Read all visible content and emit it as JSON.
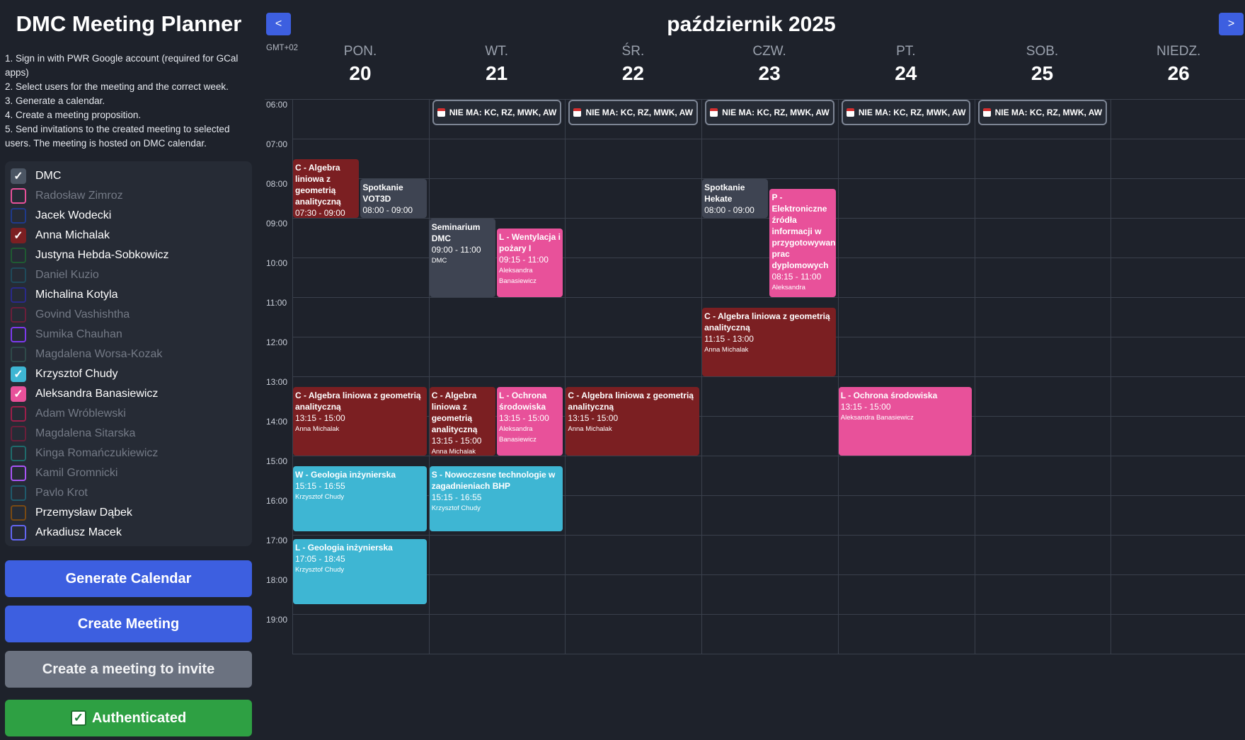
{
  "sidebar": {
    "title": "DMC Meeting Planner",
    "instructions": [
      "1. Sign in with PWR Google account (required for GCal apps)",
      "2. Select users for the meeting and the correct week.",
      "3. Generate a calendar.",
      "4. Create a meeting proposition.",
      "5. Send invitations to the created meeting to selected users. The meeting is hosted on DMC calendar."
    ],
    "users": [
      {
        "name": "DMC",
        "checked": true,
        "color": "#4b5563"
      },
      {
        "name": "Radosław Zimroz",
        "checked": false,
        "color": "#e8519a"
      },
      {
        "name": "Jacek Wodecki",
        "checked": false,
        "color": "#1f3a8a"
      },
      {
        "name": "Anna Michalak",
        "checked": true,
        "color": "#7b1f22"
      },
      {
        "name": "Justyna Hebda-Sobkowicz",
        "checked": false,
        "color": "#1f5a32"
      },
      {
        "name": "Daniel Kuzio",
        "checked": false,
        "color": "#1f4a5a"
      },
      {
        "name": "Michalina Kotyla",
        "checked": false,
        "color": "#2a2a8a"
      },
      {
        "name": "Govind Vashishtha",
        "checked": false,
        "color": "#6b1f3a"
      },
      {
        "name": "Sumika Chauhan",
        "checked": false,
        "color": "#7c3aed"
      },
      {
        "name": "Magdalena Worsa-Kozak",
        "checked": false,
        "color": "#2f4a4a"
      },
      {
        "name": "Krzysztof Chudy",
        "checked": true,
        "color": "#3eb6d3"
      },
      {
        "name": "Aleksandra Banasiewicz",
        "checked": true,
        "color": "#e8519a"
      },
      {
        "name": "Adam Wróblewski",
        "checked": false,
        "color": "#9d1f4a"
      },
      {
        "name": "Magdalena Sitarska",
        "checked": false,
        "color": "#6b1f3a"
      },
      {
        "name": "Kinga Romańczukiewicz",
        "checked": false,
        "color": "#1f6b6b"
      },
      {
        "name": "Kamil Gromnicki",
        "checked": false,
        "color": "#a855f7"
      },
      {
        "name": "Pavlo Krot",
        "checked": false,
        "color": "#1f5a6b"
      },
      {
        "name": "Przemysław Dąbek",
        "checked": false,
        "color": "#7a4a12"
      },
      {
        "name": "Arkadiusz Macek",
        "checked": false,
        "color": "#6366f1"
      }
    ],
    "buttons": {
      "generate": "Generate Calendar",
      "create_meeting": "Create Meeting",
      "create_invite": "Create a meeting to invite",
      "authenticated": "Authenticated",
      "authenticated_icon": "check-box-icon"
    }
  },
  "calendar": {
    "prev": "<",
    "next": ">",
    "month_title": "październik 2025",
    "timezone": "GMT+02",
    "days": [
      {
        "name": "PON.",
        "num": "20"
      },
      {
        "name": "WT.",
        "num": "21"
      },
      {
        "name": "ŚR.",
        "num": "22"
      },
      {
        "name": "CZW.",
        "num": "23"
      },
      {
        "name": "PT.",
        "num": "24"
      },
      {
        "name": "SOB.",
        "num": "25"
      },
      {
        "name": "NIEDZ.",
        "num": "26"
      }
    ],
    "hours": [
      "06:00",
      "07:00",
      "08:00",
      "09:00",
      "10:00",
      "11:00",
      "12:00",
      "13:00",
      "14:00",
      "15:00",
      "16:00",
      "17:00",
      "18:00",
      "19:00"
    ],
    "allday_label": "NIE MA: KC, RZ, MWK, AW",
    "allday_days": [
      1,
      2,
      3,
      4,
      5
    ],
    "events": [
      {
        "day": 0,
        "lane": 0,
        "lanes": 2,
        "start": "07:30",
        "end": "09:00",
        "color": "red",
        "title": "C - Algebra liniowa z geometrią analityczną",
        "time": "07:30 - 09:00",
        "who": ""
      },
      {
        "day": 0,
        "lane": 1,
        "lanes": 2,
        "start": "08:00",
        "end": "09:00",
        "color": "slate",
        "title": "Spotkanie VOT3D",
        "time": "08:00 - 09:00",
        "who": ""
      },
      {
        "day": 1,
        "lane": 0,
        "lanes": 2,
        "start": "09:00",
        "end": "11:00",
        "color": "slate",
        "title": "Seminarium DMC",
        "time": "09:00 - 11:00",
        "who": "DMC"
      },
      {
        "day": 1,
        "lane": 1,
        "lanes": 2,
        "start": "09:15",
        "end": "11:00",
        "color": "pink",
        "title": "L - Wentylacja i pożary I",
        "time": "09:15 - 11:00",
        "who": "Aleksandra Banasiewicz"
      },
      {
        "day": 3,
        "lane": 0,
        "lanes": 2,
        "start": "08:00",
        "end": "09:00",
        "color": "slate",
        "title": "Spotkanie Hekate",
        "time": "08:00 - 09:00",
        "who": ""
      },
      {
        "day": 3,
        "lane": 1,
        "lanes": 2,
        "start": "08:15",
        "end": "11:00",
        "color": "pink",
        "title": "P - Elektroniczne źródła informacji w przygotowywaniu prac dyplomowych",
        "time": "08:15 - 11:00",
        "who": "Aleksandra"
      },
      {
        "day": 3,
        "lane": 0,
        "lanes": 1,
        "start": "11:15",
        "end": "13:00",
        "color": "red",
        "title": "C - Algebra liniowa z geometrią analityczną",
        "time": "11:15 - 13:00",
        "who": "Anna Michalak"
      },
      {
        "day": 0,
        "lane": 0,
        "lanes": 1,
        "start": "13:15",
        "end": "15:00",
        "color": "red",
        "title": "C - Algebra liniowa z geometrią analityczną",
        "time": "13:15 - 15:00",
        "who": "Anna Michalak"
      },
      {
        "day": 1,
        "lane": 0,
        "lanes": 2,
        "start": "13:15",
        "end": "15:00",
        "color": "red",
        "title": "C - Algebra liniowa z geometrią analityczną",
        "time": "13:15 - 15:00",
        "who": "Anna Michalak"
      },
      {
        "day": 1,
        "lane": 1,
        "lanes": 2,
        "start": "13:15",
        "end": "15:00",
        "color": "pink",
        "title": "L - Ochrona środowiska",
        "time": "13:15 - 15:00",
        "who": "Aleksandra Banasiewicz"
      },
      {
        "day": 2,
        "lane": 0,
        "lanes": 1,
        "start": "13:15",
        "end": "15:00",
        "color": "red",
        "title": "C - Algebra liniowa z geometrią analityczną",
        "time": "13:15 - 15:00",
        "who": "Anna Michalak"
      },
      {
        "day": 4,
        "lane": 0,
        "lanes": 1,
        "start": "13:15",
        "end": "15:00",
        "color": "pink",
        "title": "L - Ochrona środowiska",
        "time": "13:15 - 15:00",
        "who": "Aleksandra Banasiewicz"
      },
      {
        "day": 0,
        "lane": 0,
        "lanes": 1,
        "start": "15:15",
        "end": "16:55",
        "color": "cyan",
        "title": "W - Geologia inżynierska",
        "time": "15:15 - 16:55",
        "who": "Krzysztof Chudy"
      },
      {
        "day": 1,
        "lane": 0,
        "lanes": 1,
        "start": "15:15",
        "end": "16:55",
        "color": "cyan",
        "title": "S - Nowoczesne technologie w zagadnieniach BHP",
        "time": "15:15 - 16:55",
        "who": "Krzysztof Chudy"
      },
      {
        "day": 0,
        "lane": 0,
        "lanes": 1,
        "start": "17:05",
        "end": "18:45",
        "color": "cyan",
        "title": "L - Geologia inżynierska",
        "time": "17:05 - 18:45",
        "who": "Krzysztof Chudy"
      }
    ]
  }
}
